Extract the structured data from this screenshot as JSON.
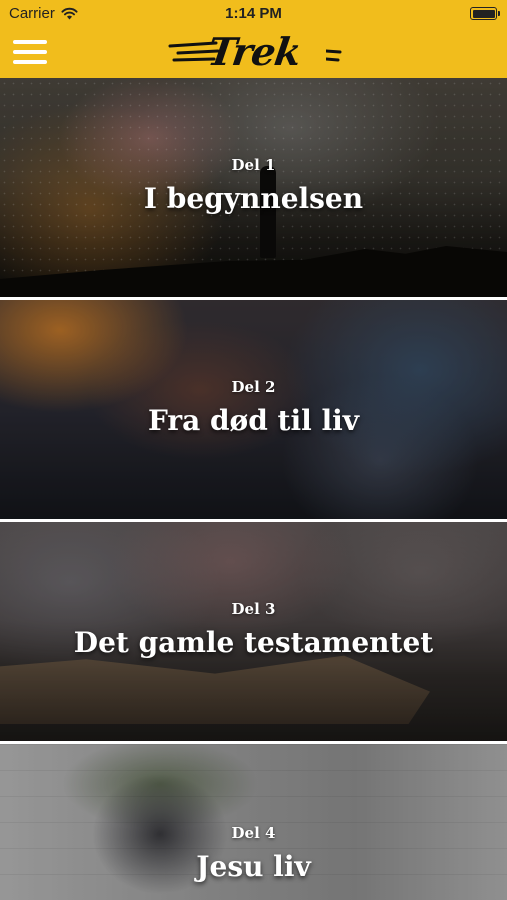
{
  "status_bar": {
    "carrier": "Carrier",
    "time": "1:14 PM",
    "icons": [
      "wifi-icon",
      "battery-icon"
    ]
  },
  "header": {
    "menu_icon": "hamburger-menu-icon",
    "logo_text": "Trek",
    "background_color": "#f1bd1c"
  },
  "cards": [
    {
      "part": "Del 1",
      "title": "I begynnelsen"
    },
    {
      "part": "Del 2",
      "title": "Fra død til liv"
    },
    {
      "part": "Del 3",
      "title": "Det gamle testamentet"
    },
    {
      "part": "Del 4",
      "title": "Jesu liv"
    }
  ]
}
